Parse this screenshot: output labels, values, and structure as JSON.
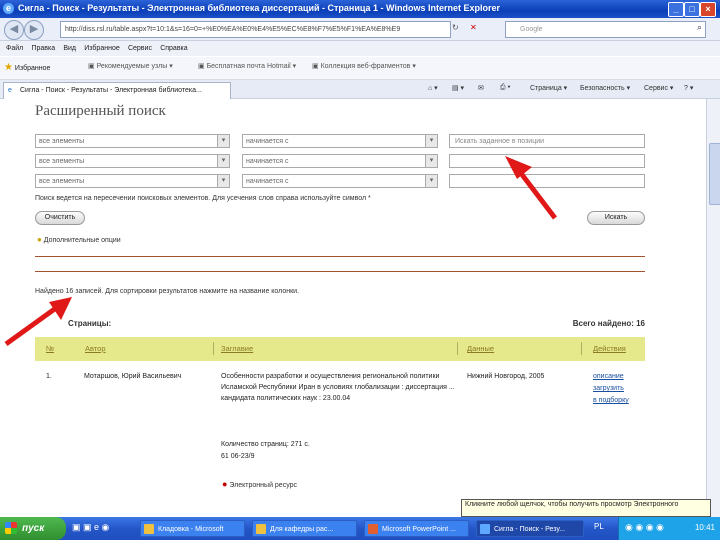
{
  "window": {
    "title": "Сигла - Поиск - Результаты - Электронная библиотека диссертаций - Страница 1 - Windows Internet Explorer"
  },
  "addressbar": {
    "url": "http://diss.rsl.ru/table.aspx?t=10:1&s=16=0=+%E0%EA%E0%E4%E5%EC%E8%F7%E5%F1%EA%E8%E9",
    "search_placeholder": "Google"
  },
  "menubar": [
    "Файл",
    "Правка",
    "Вид",
    "Избранное",
    "Сервис",
    "Справка"
  ],
  "favoritesbar": {
    "label": "Избранное",
    "items": [
      "Рекомендуемые узлы",
      "Бесплатная почта Hotmail",
      "Коллекция веб-фрагментов"
    ]
  },
  "tab": {
    "label": "Сигла - Поиск - Результаты - Электронная библиотека..."
  },
  "commandbar": {
    "page": "Страница",
    "safety": "Безопасность",
    "tools": "Сервис",
    "help": "?"
  },
  "search": {
    "title": "Расширенный поиск",
    "rows": [
      {
        "field": "все элементы",
        "condition": "начинается с",
        "value": "Искать заданное в позиции"
      },
      {
        "field": "все элементы",
        "condition": "начинается с",
        "value": ""
      },
      {
        "field": "все элементы",
        "condition": "начинается с",
        "value": ""
      }
    ],
    "hint": "Поиск ведется на пересечении поисковых элементов. Для усечения слов справа используйте символ *",
    "clear_label": "Очистить",
    "search_label": "Искать",
    "advanced_label": "Дополнительные опции"
  },
  "results": {
    "found_text": "Найдено 16 записей. Для сортировки результатов нажмите на название колонки.",
    "pages_label": "Страницы:",
    "total_label": "Всего найдено: 16",
    "columns": [
      "№",
      "Автор",
      "Заглавие",
      "Данные",
      "Действия"
    ],
    "rows": [
      {
        "num": "1.",
        "author": "Мотаршов, Юрий Васильевич",
        "title": "Особенности разработки и осуществления региональной политики Исламской Республики Иран в условиях глобализации : диссертация ... кандидата политических наук : 23.00.04",
        "pages": "Количество страниц: 271 с.",
        "code": "61 06-23/9",
        "data": "Нижний Новгород, 2005",
        "actions": [
          "описание",
          "загрузить",
          "в подборку"
        ]
      }
    ],
    "eresource": "Электронный ресурс"
  },
  "tooltip": "Кликните любой щелчок, чтобы получить просмотр Электронного",
  "taskbar": {
    "start": "пуск",
    "tasks": [
      "Кладовка - Microsoft",
      "Для кафедры рас...",
      "Microsoft PowerPoint ...",
      "Сигла - Поиск - Резу..."
    ],
    "lang": "PL",
    "clock": "10:41"
  }
}
